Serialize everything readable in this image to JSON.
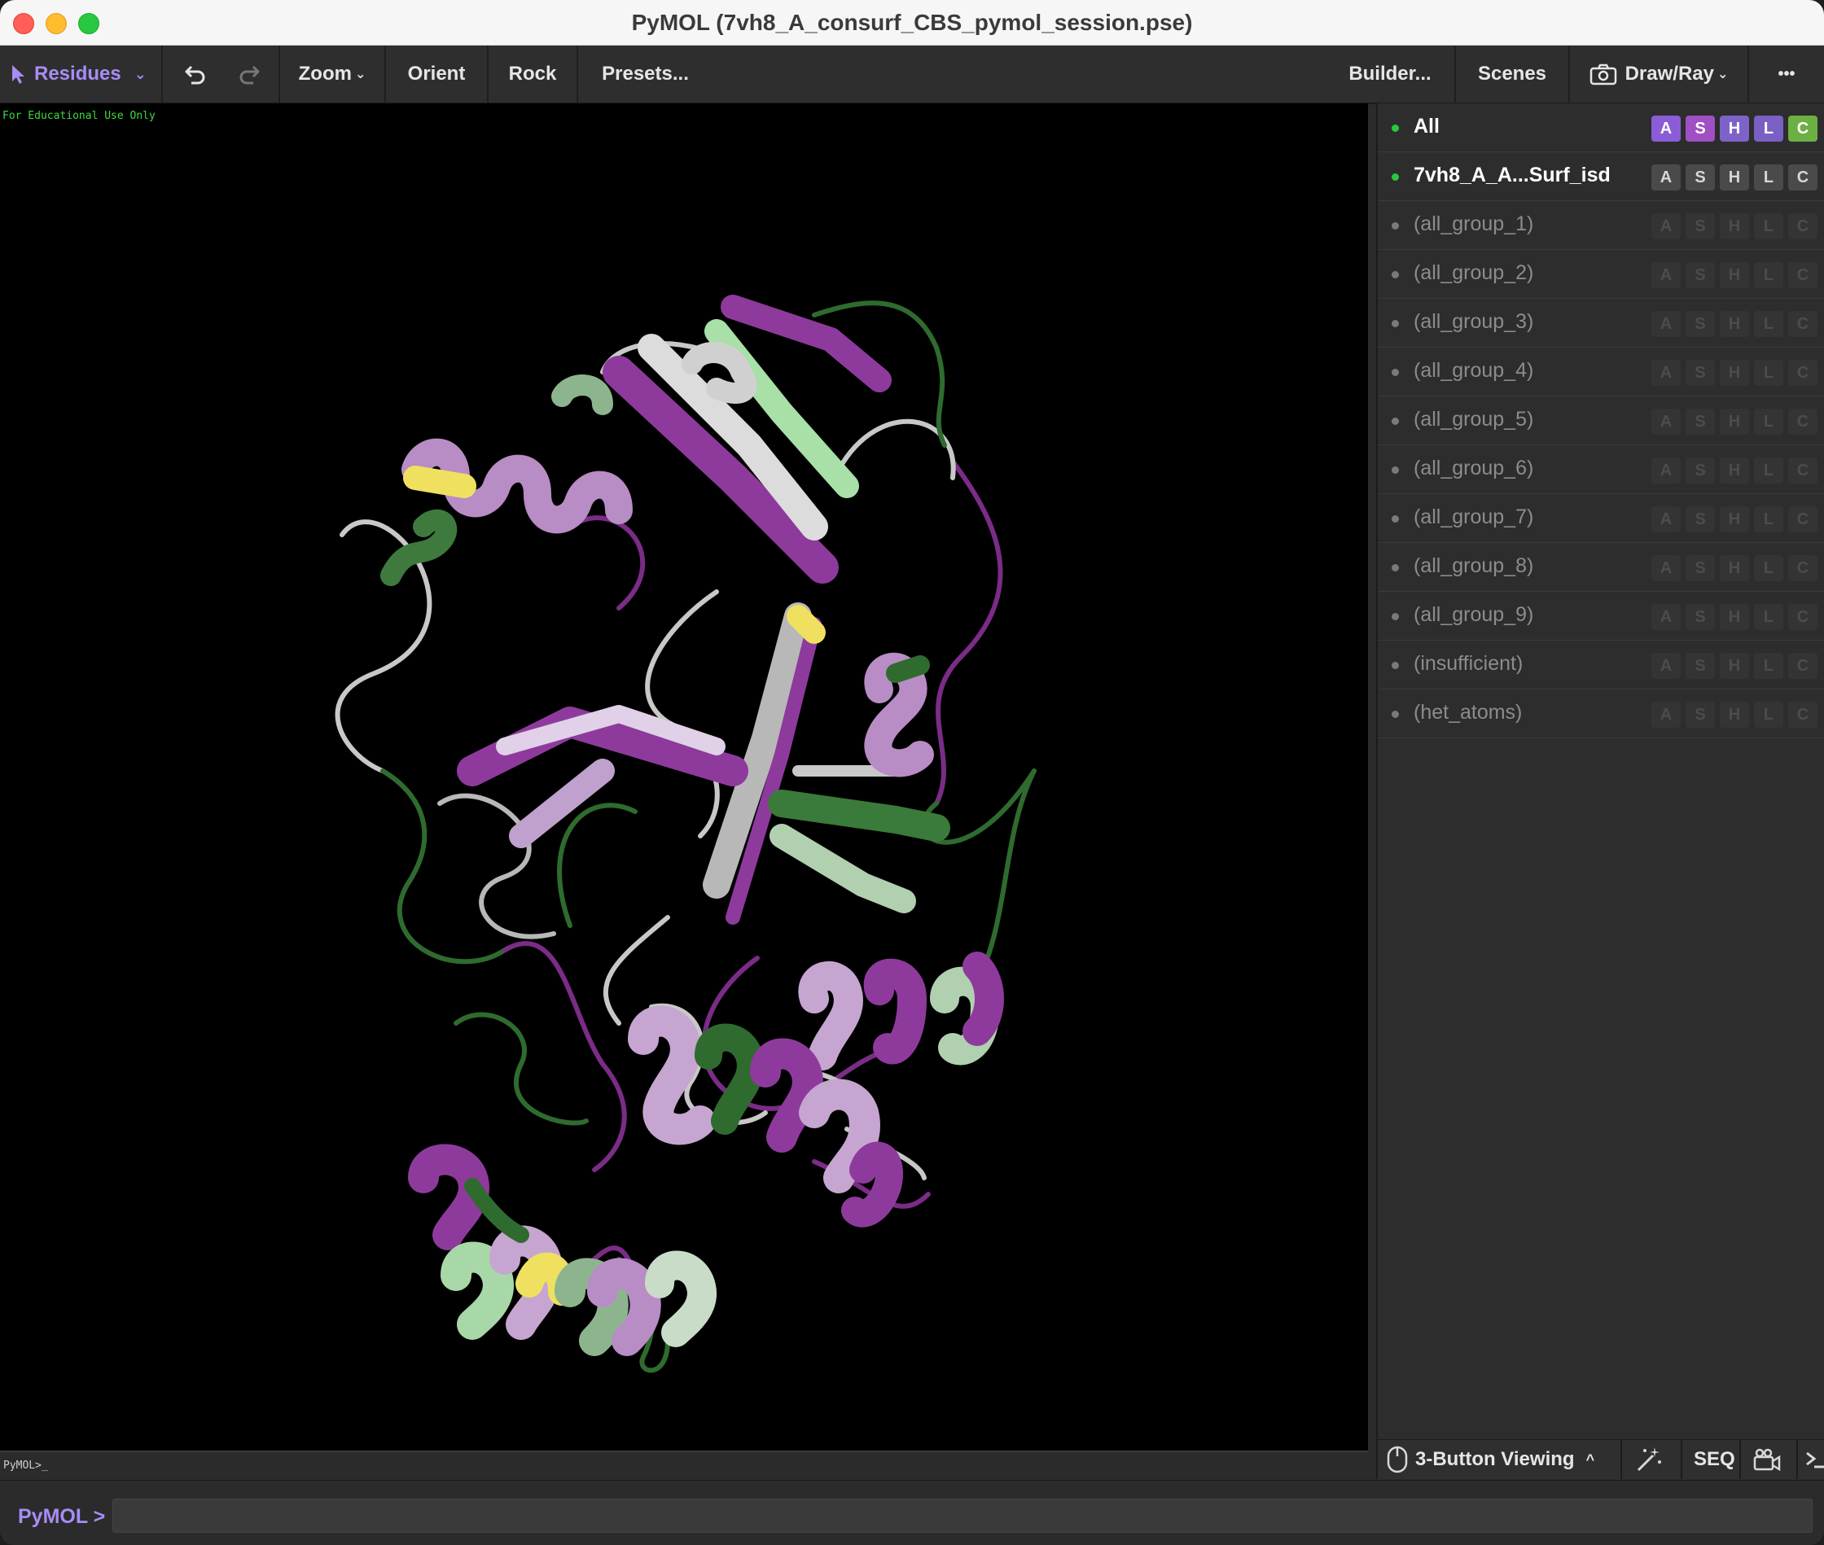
{
  "window": {
    "title": "PyMOL (7vh8_A_consurf_CBS_pymol_session.pse)"
  },
  "toolbar": {
    "mode_label": "Residues",
    "zoom_label": "Zoom",
    "orient_label": "Orient",
    "rock_label": "Rock",
    "presets_label": "Presets...",
    "builder_label": "Builder...",
    "scenes_label": "Scenes",
    "drawray_label": "Draw/Ray",
    "more_label": "•••"
  },
  "viewer": {
    "watermark": "For Educational Use Only",
    "prompt": "PyMOL>_"
  },
  "objects": [
    {
      "name": "All",
      "state": "all"
    },
    {
      "name": "7vh8_A_A...Surf_isd",
      "state": "enabled"
    },
    {
      "name": "(all_group_1)",
      "state": "disabled"
    },
    {
      "name": "(all_group_2)",
      "state": "disabled"
    },
    {
      "name": "(all_group_3)",
      "state": "disabled"
    },
    {
      "name": "(all_group_4)",
      "state": "disabled"
    },
    {
      "name": "(all_group_5)",
      "state": "disabled"
    },
    {
      "name": "(all_group_6)",
      "state": "disabled"
    },
    {
      "name": "(all_group_7)",
      "state": "disabled"
    },
    {
      "name": "(all_group_8)",
      "state": "disabled"
    },
    {
      "name": "(all_group_9)",
      "state": "disabled"
    },
    {
      "name": "(insufficient)",
      "state": "disabled"
    },
    {
      "name": "(het_atoms)",
      "state": "disabled"
    }
  ],
  "object_buttons": [
    "A",
    "S",
    "H",
    "L",
    "C"
  ],
  "colors": {
    "accent": "#a88cf5",
    "all_A": "#8a5cd6",
    "all_S": "#a04fc4",
    "all_H": "#7d63c8",
    "all_L": "#7a5fc4",
    "all_C": "#6cb043",
    "enabled_dot": "#27c93f",
    "disabled_dot": "#7a7a7a"
  },
  "panel_bottom": {
    "mouse_mode": "3-Button Viewing",
    "seq_label": "SEQ"
  },
  "command": {
    "label": "PyMOL >",
    "value": ""
  }
}
